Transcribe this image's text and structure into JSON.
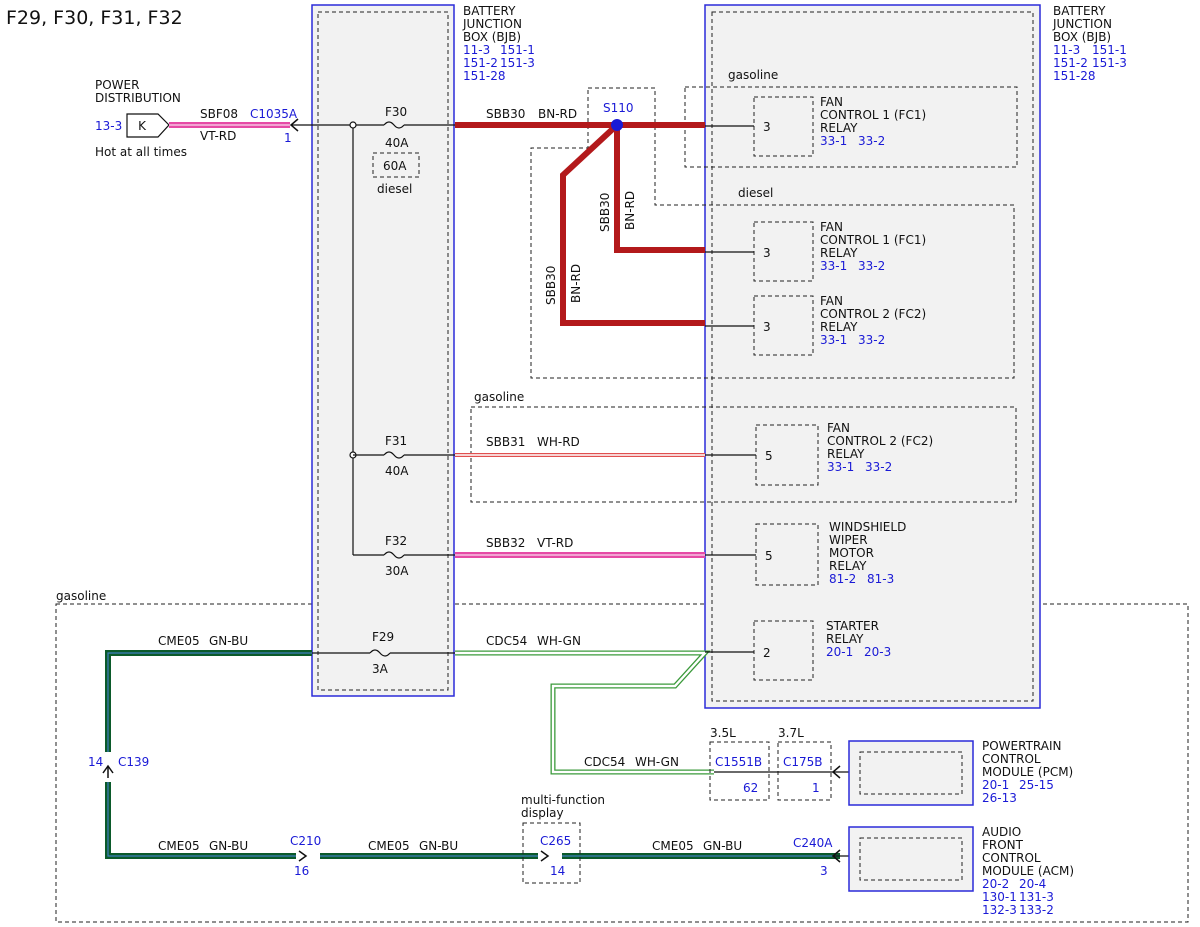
{
  "title": "F29, F30, F31, F32",
  "bjb_left": {
    "lines": [
      "BATTERY",
      "JUNCTION",
      "BOX (BJB)"
    ],
    "refs": [
      "11-3",
      "151-1",
      "151-2",
      "151-3",
      "151-28"
    ]
  },
  "bjb_right": {
    "lines": [
      "BATTERY",
      "JUNCTION",
      "BOX (BJB)"
    ],
    "refs": [
      "11-3",
      "151-1",
      "151-2",
      "151-3",
      "151-28"
    ]
  },
  "power_dist": {
    "lines": [
      "POWER",
      "DISTRIBUTION"
    ],
    "ref": "13-3",
    "pin": "K",
    "note": "Hot at all times",
    "circuit": "SBF08",
    "color": "VT-RD",
    "connector": "C1035A",
    "connector_pin": "1"
  },
  "fuses": {
    "f30": {
      "name": "F30",
      "rating": "40A",
      "alt_rating": "60A",
      "alt_label": "diesel"
    },
    "f31": {
      "name": "F31",
      "rating": "40A"
    },
    "f32": {
      "name": "F32",
      "rating": "30A"
    },
    "f29": {
      "name": "F29",
      "rating": "3A"
    }
  },
  "wires": {
    "sbb30": {
      "circuit": "SBB30",
      "color": "BN-RD"
    },
    "sbb31": {
      "circuit": "SBB31",
      "color": "WH-RD"
    },
    "sbb32": {
      "circuit": "SBB32",
      "color": "VT-RD"
    },
    "cdc54": {
      "circuit": "CDC54",
      "color": "WH-GN"
    },
    "cme05": {
      "circuit": "CME05",
      "color": "GN-BU"
    }
  },
  "splice": "S110",
  "variants": {
    "gasoline": "gasoline",
    "diesel": "diesel",
    "v35": "3.5L",
    "v37": "3.7L"
  },
  "relays": [
    {
      "id": "fc1_gas",
      "lines": [
        "FAN",
        "CONTROL 1 (FC1)",
        "RELAY"
      ],
      "refs": [
        "33-1",
        "33-2"
      ],
      "pin": "3"
    },
    {
      "id": "fc1_dsl",
      "lines": [
        "FAN",
        "CONTROL 1 (FC1)",
        "RELAY"
      ],
      "refs": [
        "33-1",
        "33-2"
      ],
      "pin": "3"
    },
    {
      "id": "fc2_dsl",
      "lines": [
        "FAN",
        "CONTROL 2 (FC2)",
        "RELAY"
      ],
      "refs": [
        "33-1",
        "33-2"
      ],
      "pin": "3"
    },
    {
      "id": "fc2_gas",
      "lines": [
        "FAN",
        "CONTROL 2 (FC2)",
        "RELAY"
      ],
      "refs": [
        "33-1",
        "33-2"
      ],
      "pin": "5"
    },
    {
      "id": "wiper",
      "lines": [
        "WINDSHIELD",
        "WIPER",
        "MOTOR",
        "RELAY"
      ],
      "refs": [
        "81-2",
        "81-3"
      ],
      "pin": "5"
    },
    {
      "id": "starter",
      "lines": [
        "STARTER",
        "RELAY"
      ],
      "refs": [
        "20-1",
        "20-3"
      ],
      "pin": "2"
    }
  ],
  "pcm": {
    "lines": [
      "POWERTRAIN",
      "CONTROL",
      "MODULE (PCM)"
    ],
    "refs": [
      "20-1",
      "25-15",
      "26-13"
    ]
  },
  "acm": {
    "lines": [
      "AUDIO",
      "FRONT",
      "CONTROL",
      "MODULE (ACM)"
    ],
    "refs": [
      "20-2",
      "20-4",
      "130-1",
      "131-3",
      "132-3",
      "133-2"
    ]
  },
  "connectors": {
    "c139": {
      "name": "C139",
      "pin": "14"
    },
    "c210": {
      "name": "C210",
      "pin": "16"
    },
    "c265": {
      "name": "C265",
      "pin": "14",
      "label": [
        "multi-function",
        "display"
      ]
    },
    "c240a": {
      "name": "C240A",
      "pin": "3"
    },
    "c1551b": {
      "name": "C1551B",
      "pin": "62"
    },
    "c175b": {
      "name": "C175B",
      "pin": "1"
    }
  },
  "colors": {
    "link": "#1a1ad6",
    "bn_rd": "#b3191b",
    "wh_rd": "#e05050",
    "vt_rd": "#e64aa6",
    "gn_bu": "#0b5a2a",
    "wh_gn": "#3b9a3b"
  }
}
